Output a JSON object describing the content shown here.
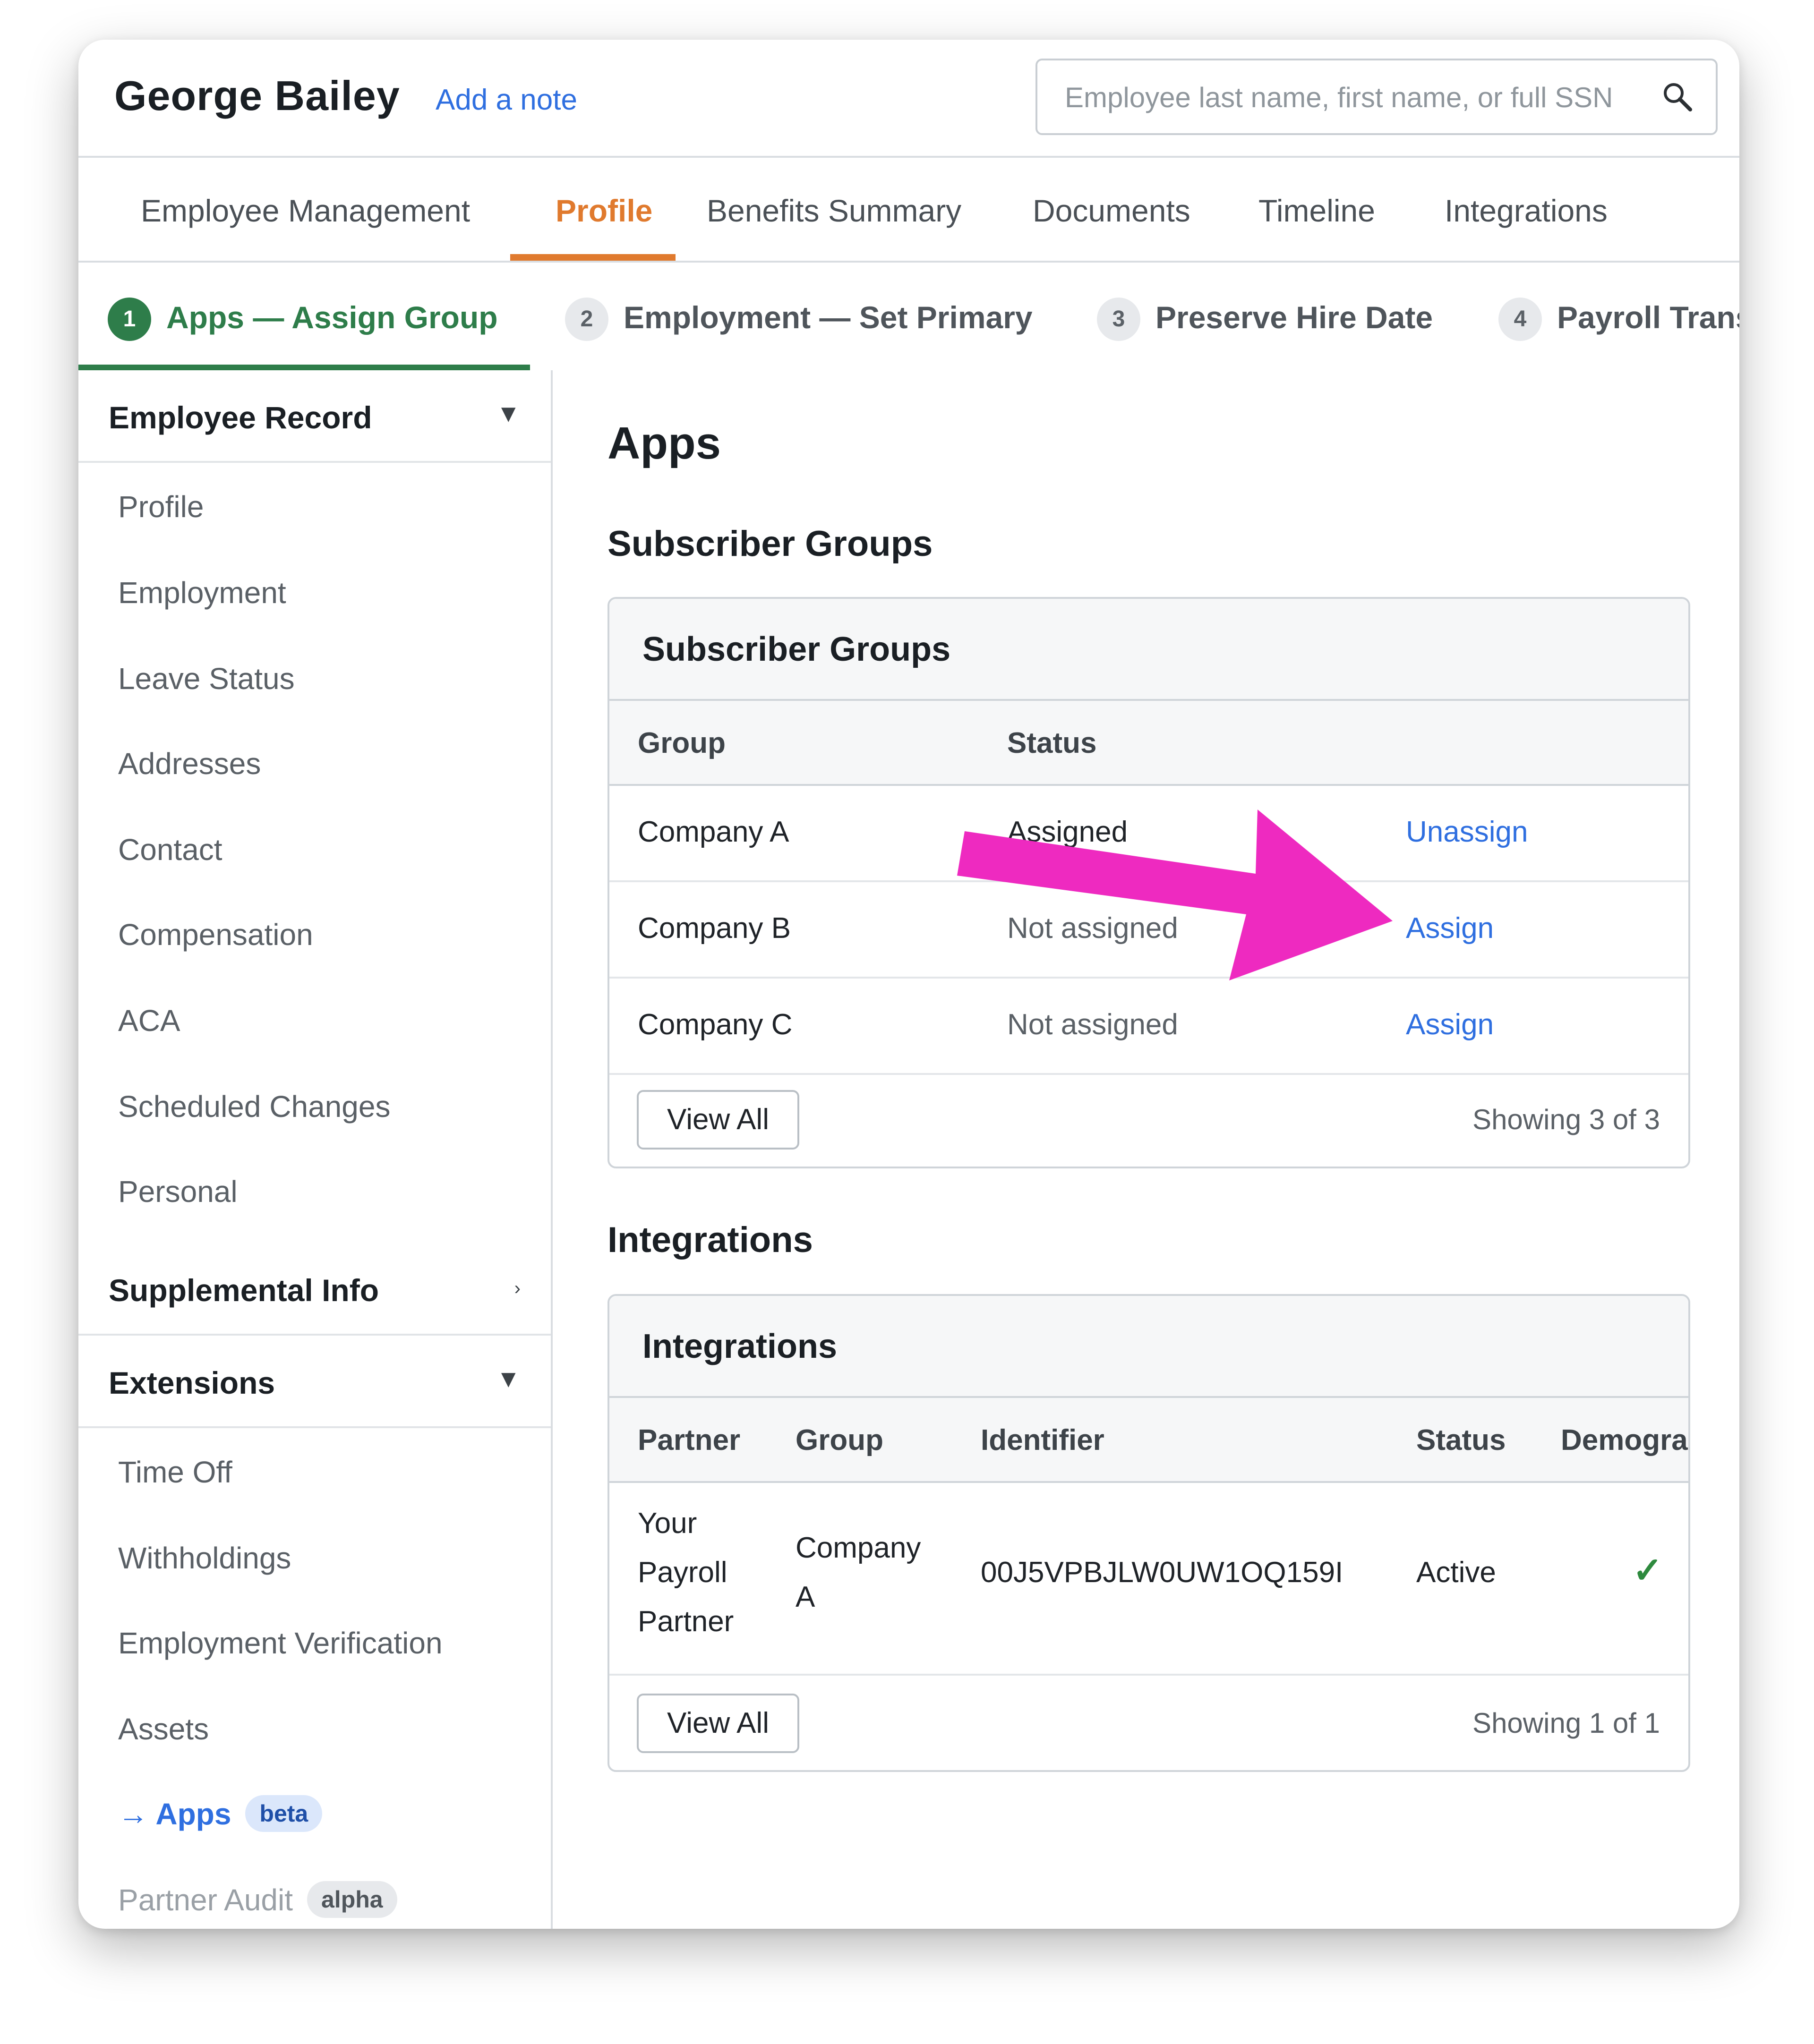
{
  "header": {
    "employee_name": "George Bailey",
    "add_note": "Add a note",
    "search_placeholder": "Employee last name, first name, or full SSN"
  },
  "tabs": [
    {
      "label": "Employee Management",
      "active": false
    },
    {
      "label": "Profile",
      "active": true
    },
    {
      "label": "Benefits Summary",
      "active": false
    },
    {
      "label": "Documents",
      "active": false
    },
    {
      "label": "Timeline",
      "active": false
    },
    {
      "label": "Integrations",
      "active": false
    }
  ],
  "steps": [
    {
      "num": "1",
      "label": "Apps — Assign Group",
      "state": "done"
    },
    {
      "num": "2",
      "label": "Employment — Set Primary",
      "state": "todo"
    },
    {
      "num": "3",
      "label": "Preserve Hire Date",
      "state": "todo"
    },
    {
      "num": "4",
      "label": "Payroll Trans",
      "state": "todo"
    }
  ],
  "sidebar": {
    "employee_record": {
      "title": "Employee Record",
      "caret": "▼",
      "items": [
        "Profile",
        "Employment",
        "Leave Status",
        "Addresses",
        "Contact",
        "Compensation",
        "ACA",
        "Scheduled Changes",
        "Personal"
      ]
    },
    "supplemental": {
      "title": "Supplemental Info",
      "caret": "›"
    },
    "extensions": {
      "title": "Extensions",
      "caret": "▼",
      "items": [
        "Time Off",
        "Withholdings",
        "Employment Verification",
        "Assets"
      ],
      "active_item": {
        "label": "→ Apps",
        "badge": "beta"
      },
      "muted_item": {
        "label": "Partner Audit",
        "badge": "alpha"
      }
    }
  },
  "main": {
    "title": "Apps",
    "subscriber_section_title": "Subscriber Groups",
    "subscriber_card": {
      "title": "Subscriber Groups",
      "columns": [
        "Group",
        "Status"
      ],
      "rows": [
        {
          "group": "Company A",
          "status": "Assigned",
          "action": "Unassign"
        },
        {
          "group": "Company B",
          "status": "Not assigned",
          "action": "Assign"
        },
        {
          "group": "Company C",
          "status": "Not assigned",
          "action": "Assign"
        }
      ],
      "view_all": "View All",
      "showing": "Showing 3 of 3"
    },
    "integrations_section_title": "Integrations",
    "integrations_card": {
      "title": "Integrations",
      "columns": [
        "Partner",
        "Group",
        "Identifier",
        "Status",
        "Demogra"
      ],
      "rows": [
        {
          "partner": [
            "Your",
            "Payroll",
            "Partner"
          ],
          "group": [
            "Company",
            "A"
          ],
          "identifier": "00J5VPBJLW0UW1OQ159I",
          "status": "Active",
          "check": "✓"
        }
      ],
      "view_all": "View All",
      "showing": "Showing 1 of 1"
    }
  },
  "annotation": {
    "arrow_color": "#ee2ac0"
  },
  "colors": {
    "accent_orange": "#e07a2e",
    "success_green": "#2e7d4a",
    "link_blue": "#2f6fe0"
  }
}
